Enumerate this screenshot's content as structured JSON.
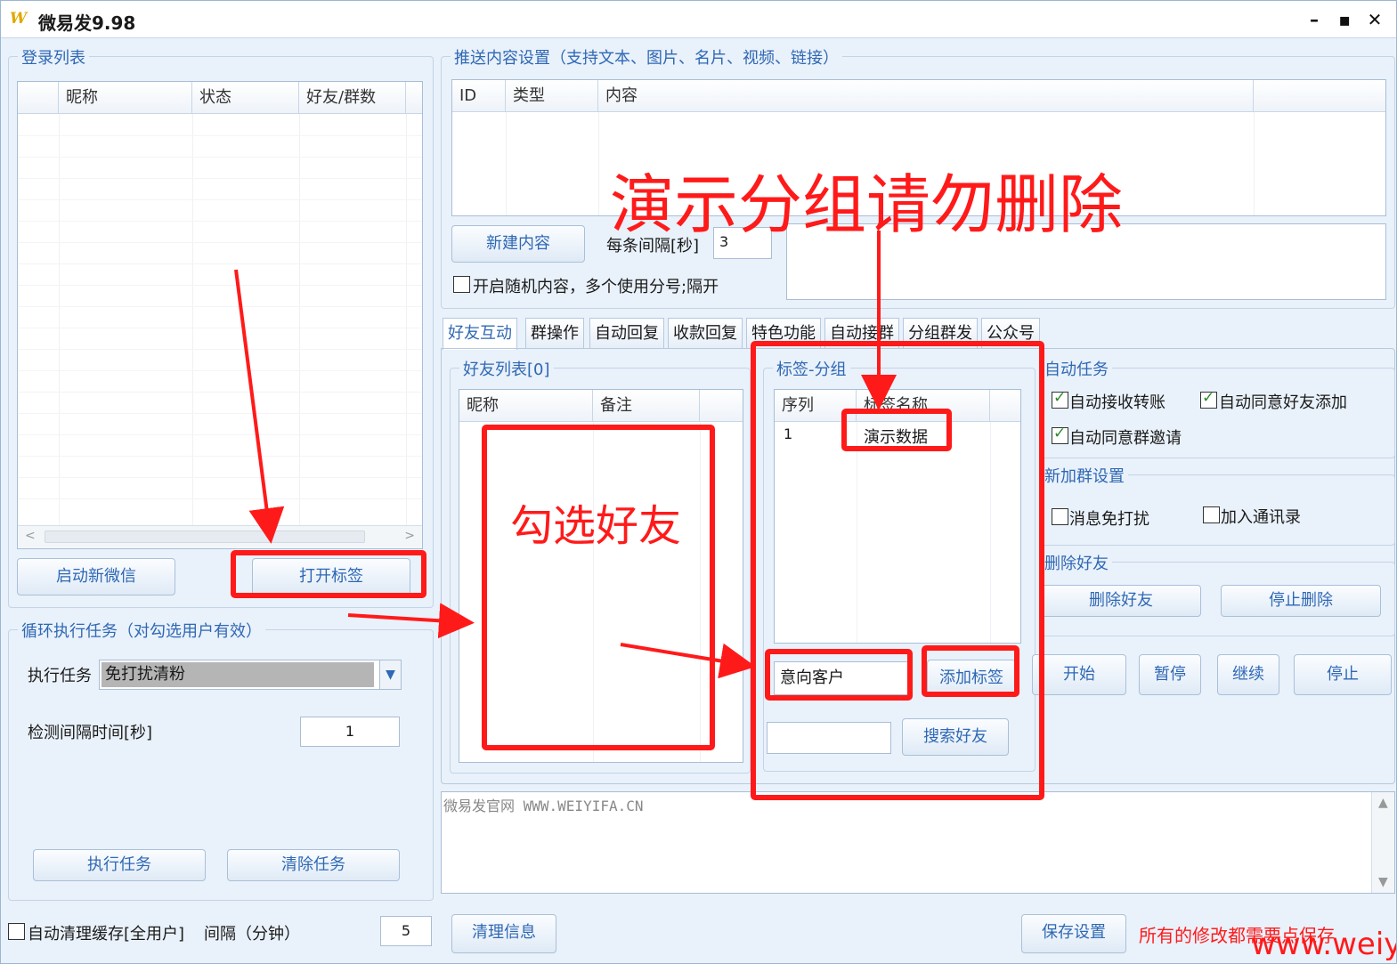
{
  "window": {
    "title": "微易发9.98",
    "icon": "app-logo-icon",
    "controls": [
      "minimize-icon",
      "maximize-icon",
      "close-icon"
    ]
  },
  "login": {
    "legend": "登录列表",
    "columns": [
      "昵称",
      "状态",
      "好友/群数"
    ],
    "start_wechat_label": "启动新微信",
    "open_tags_label": "打开标签"
  },
  "loop_task": {
    "legend": "循环执行任务（对勾选用户有效）",
    "task_label": "执行任务",
    "task_value": "免打扰清粉",
    "interval_label": "检测间隔时间[秒]",
    "interval_value": "1",
    "execute_label": "执行任务",
    "clear_label": "清除任务"
  },
  "cache": {
    "auto_clear_label": "自动清理缓存[全用户]",
    "interval_label": "间隔（分钟）",
    "interval_value": "5"
  },
  "push": {
    "legend": "推送内容设置（支持文本、图片、名片、视频、链接）",
    "columns": [
      "ID",
      "类型",
      "内容"
    ],
    "new_content_label": "新建内容",
    "interval_label": "每条间隔[秒]",
    "interval_value": "3",
    "random_label": "开启随机内容，多个使用分号;隔开"
  },
  "tabs": [
    "好友互动",
    "群操作",
    "自动回复",
    "收款回复",
    "特色功能",
    "自动接群",
    "分组群发",
    "公众号"
  ],
  "friends": {
    "legend": "好友列表[0]",
    "columns": [
      "昵称",
      "备注"
    ]
  },
  "tag_group": {
    "legend": "标签-分组",
    "columns": [
      "序列",
      "标签名称"
    ],
    "rows": [
      {
        "seq": "1",
        "name": "演示数据"
      }
    ],
    "tag_input_value": "意向客户",
    "add_tag_label": "添加标签",
    "search_placeholder": "",
    "search_label": "搜索好友"
  },
  "auto_tasks": {
    "legend": "自动任务",
    "auto_receive_transfer": "自动接收转账",
    "auto_accept_friend": "自动同意好友添加",
    "auto_accept_group": "自动同意群邀请"
  },
  "new_group": {
    "legend": "新加群设置",
    "mute": "消息免打扰",
    "add_contacts": "加入通讯录"
  },
  "delete_friends": {
    "legend": "删除好友",
    "delete_label": "删除好友",
    "stop_label": "停止删除"
  },
  "controls": {
    "start": "开始",
    "pause": "暂停",
    "resume": "继续",
    "stop": "停止"
  },
  "log": {
    "text": "微易发官网 WWW.WEIYIFA.CN"
  },
  "footer": {
    "clear_info": "清理信息",
    "save_settings": "保存设置",
    "note": "所有的修改都需要点保存",
    "watermark": "www.weiyifa.cn"
  },
  "annotations": {
    "demo_warning": "演示分组请勿删除",
    "select_friends": "勾选好友"
  },
  "colors": {
    "accent": "#2f68b4",
    "annotation_red": "#ff1a1a",
    "background": "#e9f1fa"
  }
}
